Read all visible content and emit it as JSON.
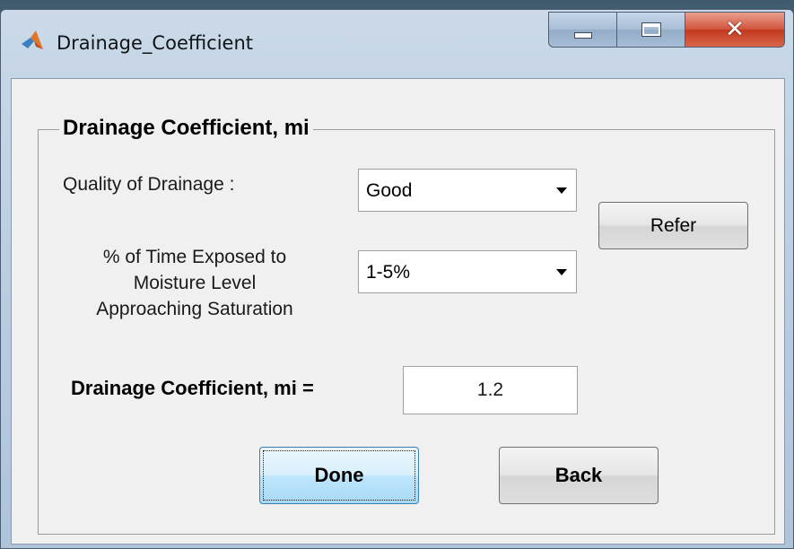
{
  "window": {
    "title": "Drainage_Coefficient",
    "controls": {
      "minimize": "minimize",
      "maximize": "maximize",
      "close": "close"
    }
  },
  "panel": {
    "title": "Drainage Coefficient, mi",
    "quality_label": "Quality of Drainage  :",
    "quality_value": "Good",
    "time_label_lines": [
      "% of Time Exposed to",
      "Moisture Level",
      "Approaching Saturation"
    ],
    "time_value": "1-5%",
    "refer_label": "Refer",
    "coef_label": "Drainage Coefficient, mi  =",
    "coef_value": "1.2",
    "done_label": "Done",
    "back_label": "Back"
  },
  "icons": {
    "app": "matlab-icon",
    "minimize": "minimize-icon",
    "maximize": "maximize-icon",
    "close": "close-icon",
    "dropdown": "chevron-down-icon"
  },
  "colors": {
    "close_button": "#d2563f",
    "done_button": "#bee6fd",
    "client_background": "#f0f0f0"
  }
}
